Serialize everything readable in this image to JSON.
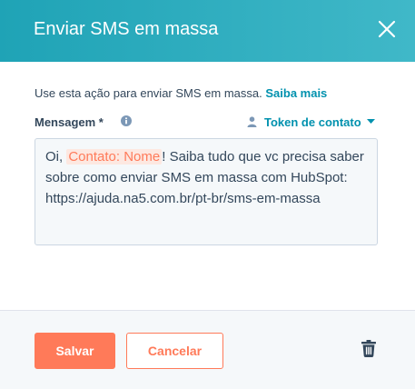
{
  "header": {
    "title": "Enviar SMS em massa",
    "close_icon": "close-icon"
  },
  "description": {
    "text": "Use esta ação para enviar SMS em massa.",
    "link_label": "Saiba mais"
  },
  "message_field": {
    "label": "Mensagem *",
    "info_icon": "info-icon",
    "token_dropdown_label": "Token de contato",
    "value": {
      "prefix": "Oi, ",
      "token": "Contato: Nome",
      "suffix": "! Saiba tudo que vc precisa saber sobre como enviar SMS em massa com HubSpot: https://ajuda.na5.com.br/pt-br/sms-em-massa"
    }
  },
  "footer": {
    "save_label": "Salvar",
    "cancel_label": "Cancelar",
    "delete_icon": "trash-icon"
  },
  "colors": {
    "header_gradient_start": "#1fa3b6",
    "header_gradient_end": "#40b8c8",
    "primary_orange": "#ff7a59",
    "link_teal": "#0091ae",
    "text_dark": "#33475b",
    "footer_bg": "#f5f8fa"
  }
}
